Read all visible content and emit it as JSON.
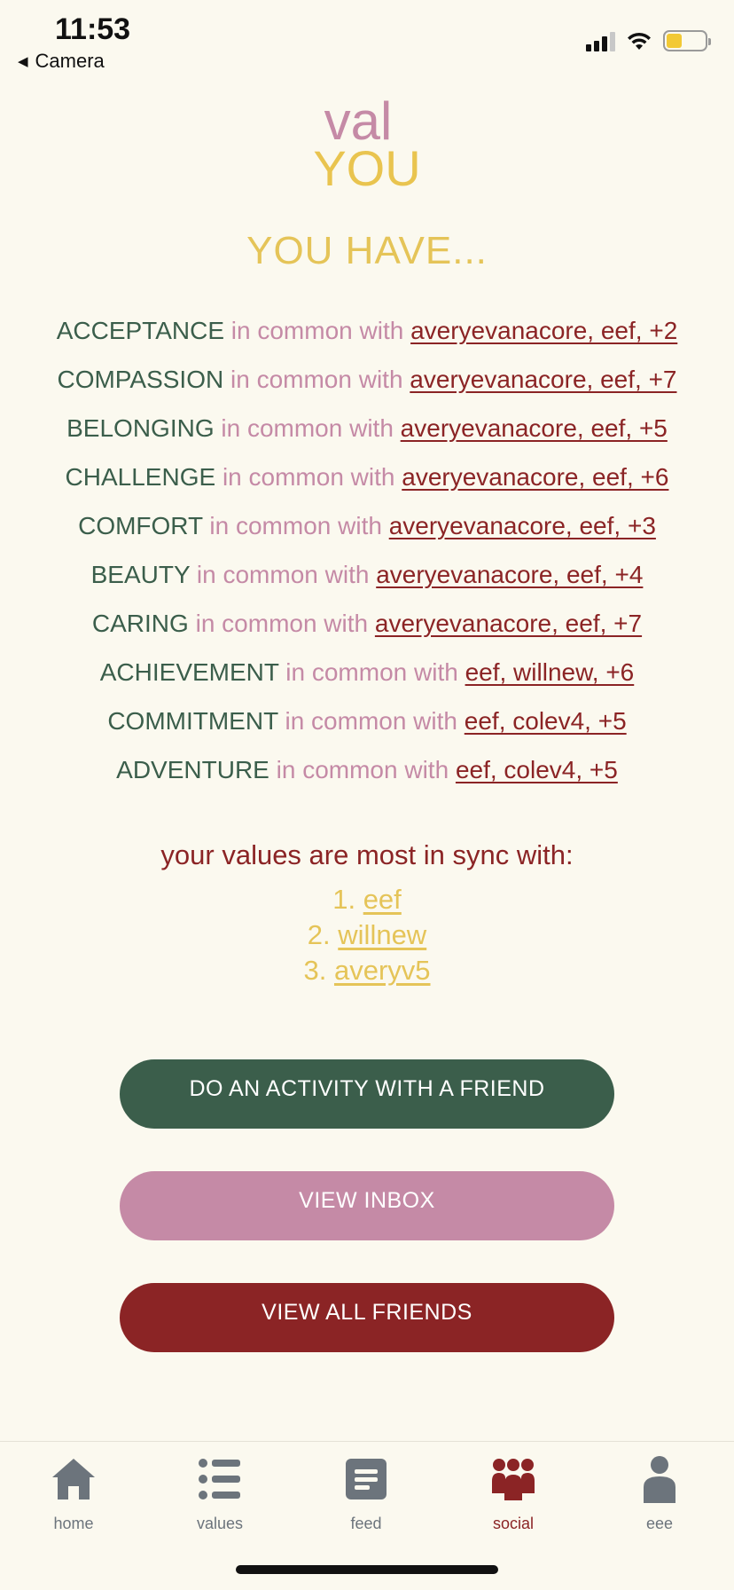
{
  "status": {
    "time": "11:53",
    "back_label": "Camera"
  },
  "logo": {
    "top": "val",
    "bottom": "YOU"
  },
  "heading": "YOU HAVE...",
  "common_connector": "in common with",
  "common": [
    {
      "value": "ACCEPTANCE",
      "friends": "averyevanacore, eef, +2"
    },
    {
      "value": "COMPASSION",
      "friends": "averyevanacore, eef, +7"
    },
    {
      "value": "BELONGING",
      "friends": "averyevanacore, eef, +5"
    },
    {
      "value": "CHALLENGE",
      "friends": "averyevanacore, eef, +6"
    },
    {
      "value": "COMFORT",
      "friends": "averyevanacore, eef, +3"
    },
    {
      "value": "BEAUTY",
      "friends": "averyevanacore, eef, +4"
    },
    {
      "value": "CARING",
      "friends": "averyevanacore, eef, +7"
    },
    {
      "value": "ACHIEVEMENT",
      "friends": "eef, willnew, +6"
    },
    {
      "value": "COMMITMENT",
      "friends": "eef, colev4, +5"
    },
    {
      "value": "ADVENTURE",
      "friends": "eef, colev4, +5"
    }
  ],
  "sync": {
    "title": "your values are most in sync with:",
    "items": [
      {
        "num": "1.",
        "name": "eef"
      },
      {
        "num": "2.",
        "name": "willnew"
      },
      {
        "num": "3.",
        "name": "averyv5"
      }
    ]
  },
  "buttons": {
    "activity": "DO AN ACTIVITY WITH A FRIEND",
    "inbox": "VIEW INBOX",
    "friends": "VIEW ALL FRIENDS"
  },
  "tabs": [
    {
      "label": "home",
      "icon": "home-icon"
    },
    {
      "label": "values",
      "icon": "list-icon"
    },
    {
      "label": "feed",
      "icon": "feed-icon"
    },
    {
      "label": "social",
      "icon": "people-icon",
      "active": true
    },
    {
      "label": "eee",
      "icon": "user-icon"
    }
  ],
  "colors": {
    "background": "#fbf9ef",
    "green": "#3b5e4b",
    "pink": "#c58aa6",
    "maroon": "#8b2425",
    "yellow": "#e5c458",
    "tab_inactive": "#6c747c"
  }
}
